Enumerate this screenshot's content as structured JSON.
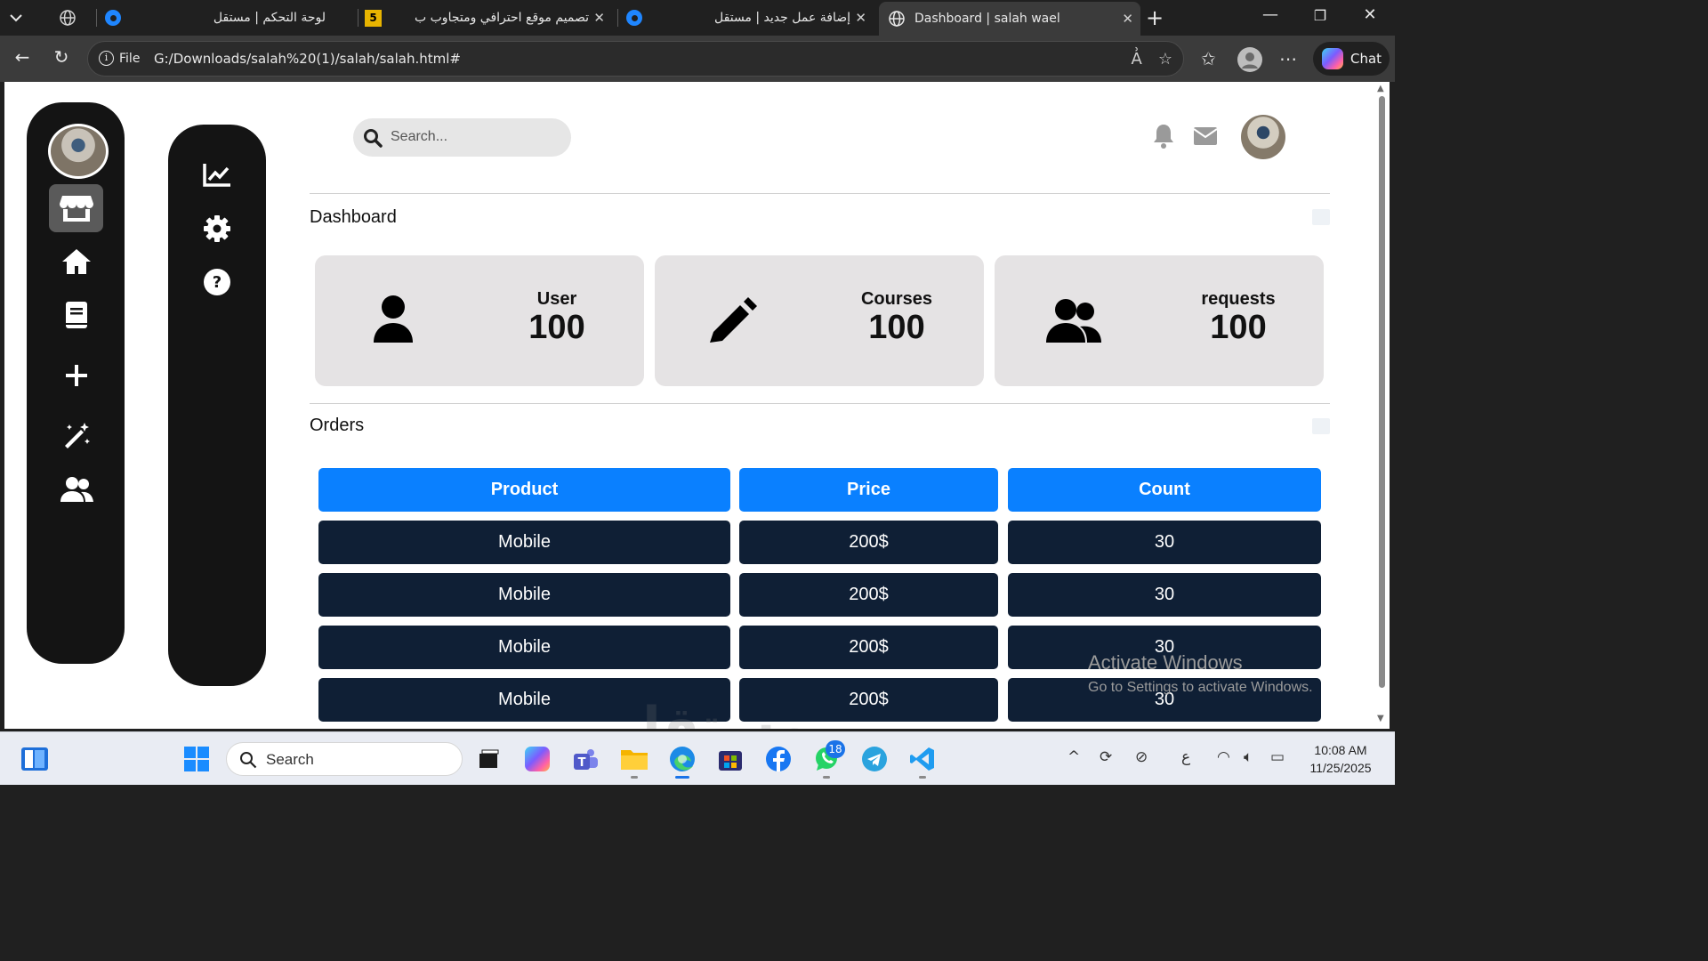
{
  "browser": {
    "tabs": [
      {
        "title": "لوحة التحكم | مستقل",
        "active": false
      },
      {
        "title": "تصميم موقع احترافي ومتجاوب ب",
        "active": false
      },
      {
        "title": "إضافة عمل جديد | مستقل",
        "active": false
      },
      {
        "title": "Dashboard | salah wael",
        "active": true
      }
    ],
    "address": {
      "scheme_label": "File",
      "url": "G:/Downloads/salah%20(1)/salah/salah.html#"
    },
    "chat_label": "Chat"
  },
  "header": {
    "search_placeholder": "Search..."
  },
  "sections": {
    "dashboard": "Dashboard",
    "orders": "Orders"
  },
  "cards": [
    {
      "label": "User",
      "value": "100",
      "icon": "user-icon"
    },
    {
      "label": "Courses",
      "value": "100",
      "icon": "pencil-icon"
    },
    {
      "label": "requests",
      "value": "100",
      "icon": "users-icon"
    }
  ],
  "orders": {
    "headers": [
      "Product",
      "Price",
      "Count"
    ],
    "rows": [
      [
        "Mobile",
        "200$",
        "30"
      ],
      [
        "Mobile",
        "200$",
        "30"
      ],
      [
        "Mobile",
        "200$",
        "30"
      ],
      [
        "Mobile",
        "200$",
        "30"
      ]
    ]
  },
  "os": {
    "activate_title": "Activate Windows",
    "activate_sub": "Go to Settings to activate Windows.",
    "watermark": "مستقل",
    "taskbar_search": "Search",
    "whatsapp_badge": "18",
    "time": "10:08 AM",
    "date": "11/25/2025",
    "lang": "ع"
  },
  "colors": {
    "accent": "#0a80ff",
    "row_bg": "#0f1f35",
    "sidebar_bg": "#141414",
    "card_bg": "#e5e3e4"
  }
}
